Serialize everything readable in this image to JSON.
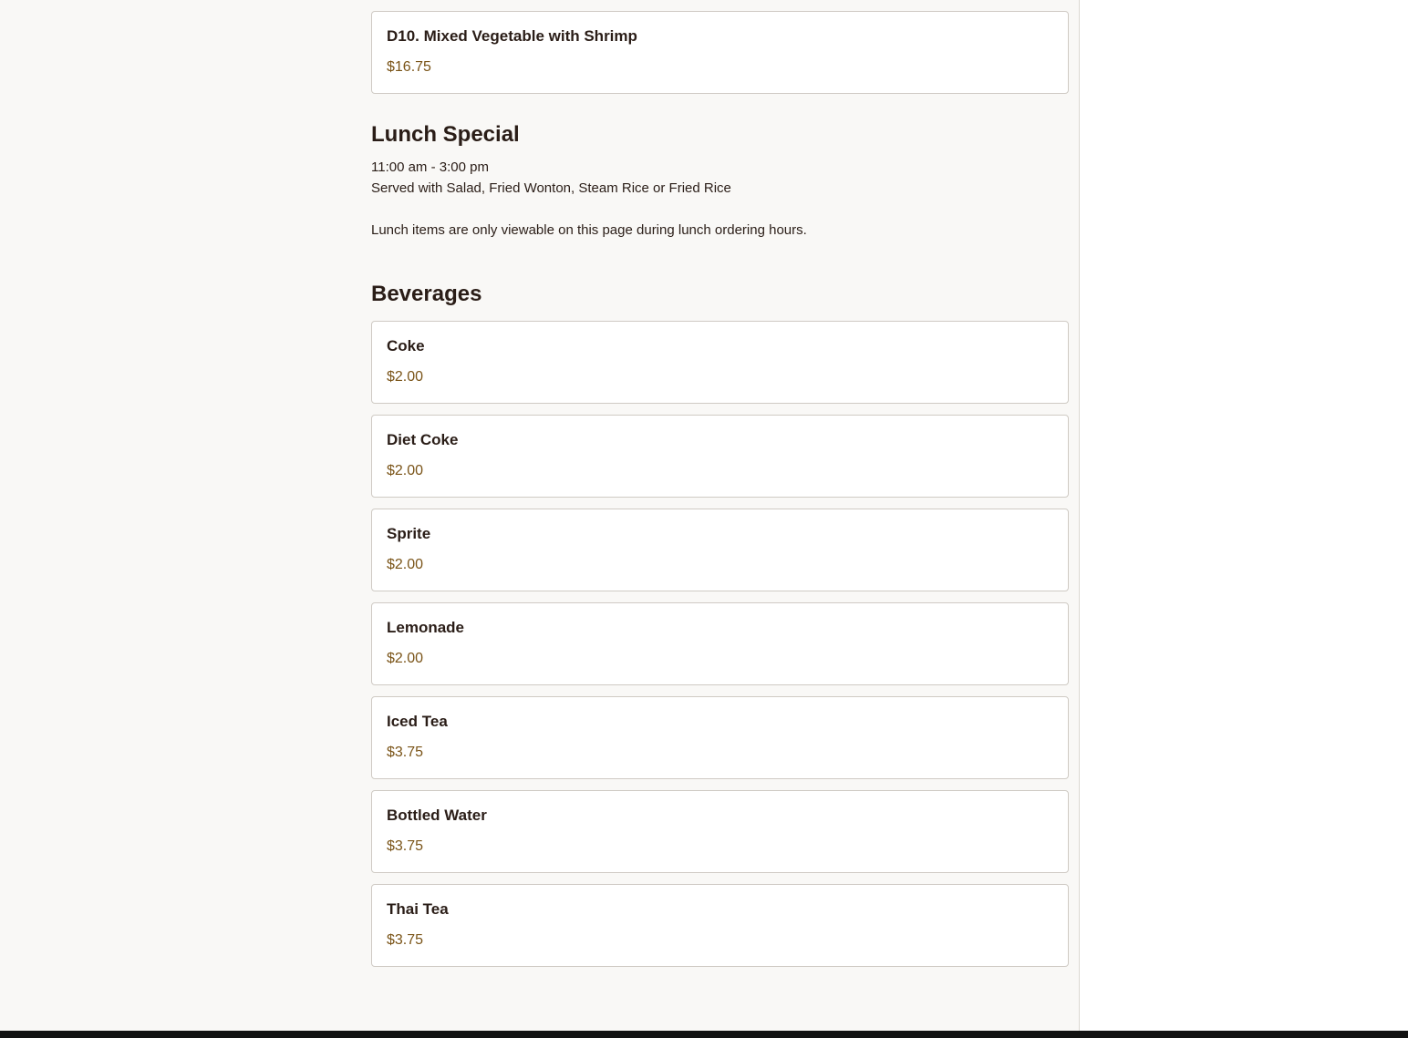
{
  "dinner_tail": {
    "items": [
      {
        "name": "D10. Mixed Vegetable with Shrimp",
        "price": "$16.75"
      }
    ]
  },
  "lunch_special": {
    "title": "Lunch Special",
    "hours": "11:00 am - 3:00 pm",
    "served_with": "Served with Salad, Fried Wonton, Steam Rice or Fried Rice",
    "notice": "Lunch items are only viewable on this page during lunch ordering hours."
  },
  "beverages": {
    "title": "Beverages",
    "items": [
      {
        "name": "Coke",
        "price": "$2.00"
      },
      {
        "name": "Diet Coke",
        "price": "$2.00"
      },
      {
        "name": "Sprite",
        "price": "$2.00"
      },
      {
        "name": "Lemonade",
        "price": "$2.00"
      },
      {
        "name": "Iced Tea",
        "price": "$3.75"
      },
      {
        "name": "Bottled Water",
        "price": "$3.75"
      },
      {
        "name": "Thai Tea",
        "price": "$3.75"
      }
    ]
  },
  "colors": {
    "page_background": "#f9f8f6",
    "card_background": "#ffffff",
    "text": "#2a1d17",
    "price": "#7a5418",
    "footer_bar": "#121212"
  }
}
